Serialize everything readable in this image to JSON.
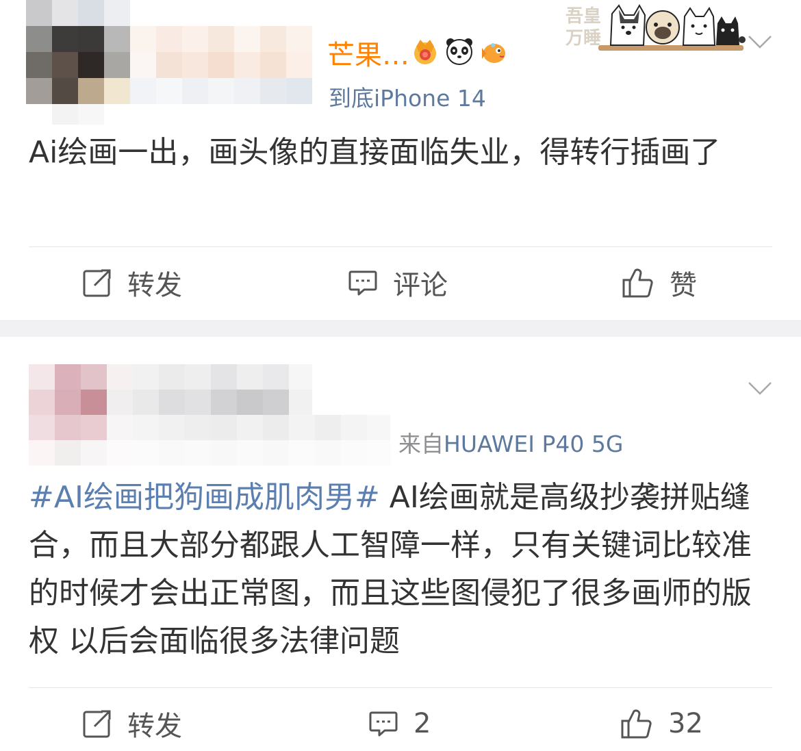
{
  "colors": {
    "accent_orange": "#ff8200",
    "link_blue": "#5b7fb0",
    "meta_blue": "#5d7a9e",
    "text_primary": "#333333",
    "text_secondary": "#8e8e93",
    "separator": "#f1f1f3"
  },
  "post1": {
    "name_tail": "芒果…",
    "badges": [
      "crown-badge-icon",
      "panda-emoji-icon",
      "fish-emoji-icon"
    ],
    "source_device": "到底iPhone 14",
    "sticker_text": "吾皇万睡",
    "body": "Ai绘画一出，画头像的直接面临失业，得转行插画了",
    "actions": {
      "repost_label": "转发",
      "comment_label": "评论",
      "like_label": "赞"
    }
  },
  "post2": {
    "source_prefix": "来自",
    "source_device": "HUAWEI P40 5G",
    "hashtag": "#AI绘画把狗画成肌肉男#",
    "body": " AI绘画就是高级抄袭拼贴缝合，而且大部分都跟人工智障一样，只有关键词比较准的时候才会出正常图，而且这些图侵犯了很多画师的版权 以后会面临很多法律问题",
    "actions": {
      "repost_label": "转发",
      "comment_count": "2",
      "like_count": "32"
    }
  }
}
